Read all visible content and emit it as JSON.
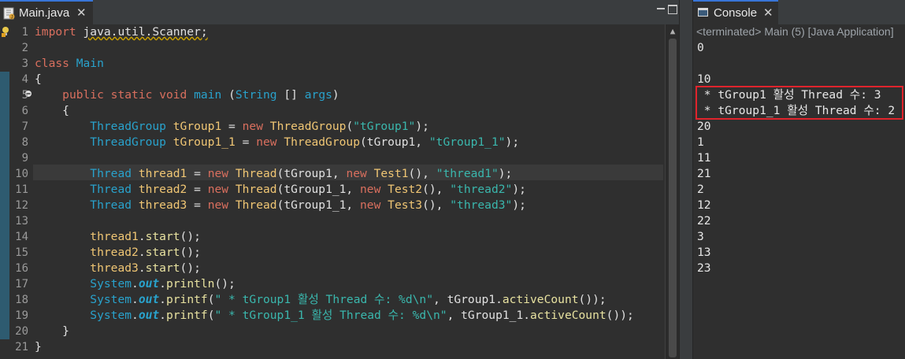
{
  "editor": {
    "tab_title": "Main.java",
    "tab_close": "✕",
    "line_numbers": [
      "1",
      "2",
      "3",
      "4",
      "5",
      "6",
      "7",
      "8",
      "9",
      "10",
      "11",
      "12",
      "13",
      "14",
      "15",
      "16",
      "17",
      "18",
      "19",
      "20",
      "21"
    ],
    "code": {
      "l1": {
        "import": "import",
        "pkg": "java.util.Scanner;"
      },
      "l3": {
        "class": "class",
        "name": "Main"
      },
      "l4": "{",
      "l5": {
        "public": "public",
        "static": "static",
        "void": "void",
        "main": "main",
        "p1": " (",
        "string": "String",
        "p2": " [] ",
        "args": "args",
        "p3": ")"
      },
      "l6": "{",
      "l7": {
        "type": "ThreadGroup",
        "var": "tGroup1",
        "eq": " = ",
        "new": "new",
        "ctor": "ThreadGroup",
        "p1": "(",
        "str": "\"tGroup1\"",
        "p2": ");"
      },
      "l8": {
        "type": "ThreadGroup",
        "var": "tGroup1_1",
        "eq": " = ",
        "new": "new",
        "ctor": "ThreadGroup",
        "p1": "(tGroup1, ",
        "str": "\"tGroup1_1\"",
        "p2": ");"
      },
      "l10": {
        "type": "Thread",
        "var": "thread1",
        "eq": " = ",
        "new": "new",
        "ctor": "Thread",
        "p1": "(tGroup1, ",
        "new2": "new",
        "cls": "Test1",
        "p2": "(), ",
        "str": "\"thread1\"",
        "p3": ");"
      },
      "l11": {
        "type": "Thread",
        "var": "thread2",
        "eq": " = ",
        "new": "new",
        "ctor": "Thread",
        "p1": "(tGroup1_1, ",
        "new2": "new",
        "cls": "Test2",
        "p2": "(), ",
        "str": "\"thread2\"",
        "p3": ");"
      },
      "l12": {
        "type": "Thread",
        "var": "thread3",
        "eq": " = ",
        "new": "new",
        "ctor": "Thread",
        "p1": "(tGroup1_1, ",
        "new2": "new",
        "cls": "Test3",
        "p2": "(), ",
        "str": "\"thread3\"",
        "p3": ");"
      },
      "l14": {
        "var": "thread1",
        "dot": ".",
        "method": "start",
        "p": "();"
      },
      "l15": {
        "var": "thread2",
        "dot": ".",
        "method": "start",
        "p": "();"
      },
      "l16": {
        "var": "thread3",
        "dot": ".",
        "method": "start",
        "p": "();"
      },
      "l17": {
        "sys": "System",
        "dot1": ".",
        "out": "out",
        "dot2": ".",
        "method": "println",
        "p": "();"
      },
      "l18": {
        "sys": "System",
        "dot1": ".",
        "out": "out",
        "dot2": ".",
        "method": "printf",
        "p1": "(",
        "str": "\" * tGroup1 활성 Thread 수: %d\\n\"",
        "p2": ", tGroup1.",
        "method2": "activeCount",
        "p3": "());"
      },
      "l19": {
        "sys": "System",
        "dot1": ".",
        "out": "out",
        "dot2": ".",
        "method": "printf",
        "p1": "(",
        "str": "\" * tGroup1_1 활성 Thread 수: %d\\n\"",
        "p2": ", tGroup1_1.",
        "method2": "activeCount",
        "p3": "());"
      },
      "l20": "}",
      "l21": "}"
    }
  },
  "console": {
    "tab_title": "Console",
    "tab_close": "✕",
    "status": "<terminated> Main (5) [Java Application]",
    "lines": [
      "0",
      "",
      "10",
      " * tGroup1 활성 Thread 수: 3",
      " * tGroup1_1 활성 Thread 수: 2",
      "20",
      "1",
      "11",
      "21",
      "2",
      "12",
      "22",
      "3",
      "13",
      "23"
    ]
  },
  "colors": {
    "keyword": "#d96f5e",
    "type": "#29a2cc",
    "string": "#3ab7ad",
    "variable": "#f0c674",
    "highlight_box": "#e0242c"
  }
}
